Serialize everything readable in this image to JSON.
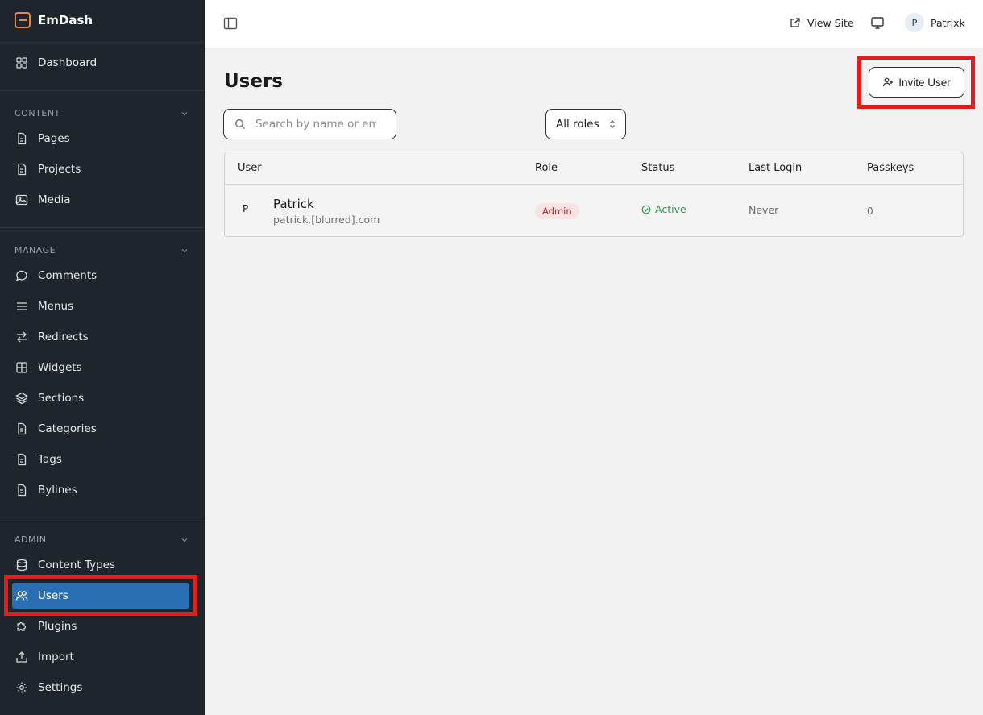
{
  "app": {
    "name": "EmDash"
  },
  "sidebar": {
    "dashboard": "Dashboard",
    "sections": [
      {
        "label": "CONTENT",
        "items": [
          "Pages",
          "Projects",
          "Media"
        ]
      },
      {
        "label": "MANAGE",
        "items": [
          "Comments",
          "Menus",
          "Redirects",
          "Widgets",
          "Sections",
          "Categories",
          "Tags",
          "Bylines"
        ]
      },
      {
        "label": "ADMIN",
        "items": [
          "Content Types",
          "Users",
          "Plugins",
          "Import",
          "Settings"
        ]
      }
    ],
    "active_item": "Users"
  },
  "topbar": {
    "view_site": "View Site",
    "user_initial": "P",
    "user_name": "Patrixk"
  },
  "main": {
    "title": "Users",
    "invite_button": "Invite User",
    "search_placeholder": "Search by name or em",
    "role_filter": "All roles",
    "table": {
      "columns": [
        "User",
        "Role",
        "Status",
        "Last Login",
        "Passkeys"
      ],
      "rows": [
        {
          "initial": "P",
          "name": "Patrick",
          "email": "patrick.[blurred].com",
          "role": "Admin",
          "status": "Active",
          "last_login": "Never",
          "passkeys": "0"
        }
      ]
    }
  },
  "colors": {
    "sidebar_bg": "#1f252c",
    "active_bg": "#2a6fb3",
    "brand_accent": "#e8873a",
    "admin_badge_bg": "#fbe3e3",
    "admin_badge_text": "#b1262b",
    "status_active": "#2f9a4b",
    "highlight": "#e01e1e"
  }
}
